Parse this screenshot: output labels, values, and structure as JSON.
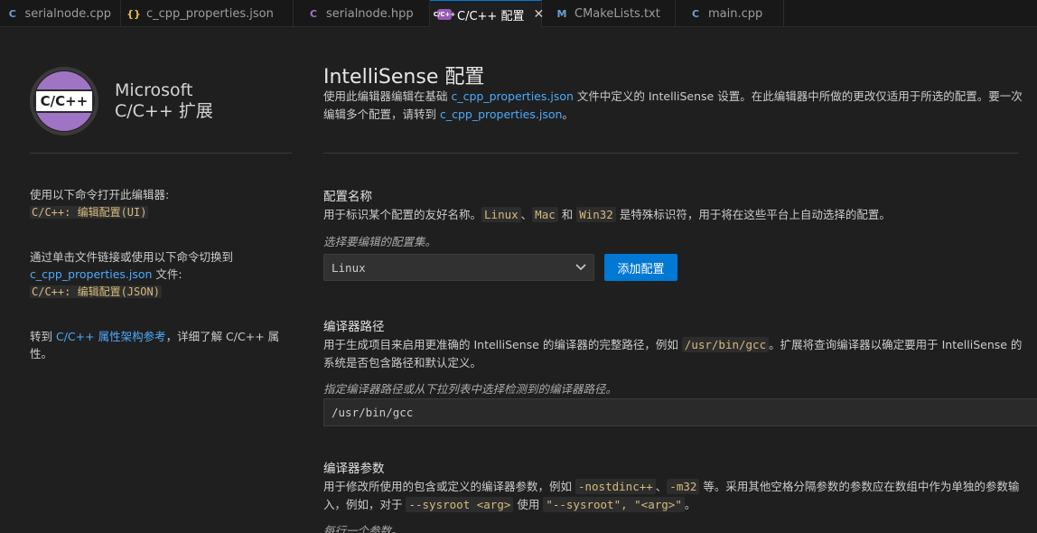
{
  "tabs": [
    {
      "label": "serialnode.cpp",
      "icon": "cpp-file-icon",
      "glyph": "C",
      "active": false
    },
    {
      "label": "c_cpp_properties.json",
      "icon": "json-file-icon",
      "glyph": "{}",
      "active": false
    },
    {
      "label": "serialnode.hpp",
      "icon": "hpp-file-icon",
      "glyph": "C",
      "active": false
    },
    {
      "label": "C/C++ 配置",
      "icon": "extension-icon",
      "glyph": "C/C++",
      "active": true
    },
    {
      "label": "CMakeLists.txt",
      "icon": "cmake-file-icon",
      "glyph": "M",
      "active": false
    },
    {
      "label": "main.cpp",
      "icon": "cpp-file-icon",
      "glyph": "C",
      "active": false
    }
  ],
  "tab_close_glyph": "✕",
  "sidebar": {
    "logo_text": "C/C++",
    "brand_line1": "Microsoft",
    "brand_line2": "C/C++ 扩展",
    "block1_text": "使用以下命令打开此编辑器:",
    "block1_cmd": "C/C++: 编辑配置(UI)",
    "block2_text": "通过单击文件链接或使用以下命令切换到",
    "block2_link": "c_cpp_properties.json",
    "block2_after": " 文件:",
    "block2_cmd": "C/C++: 编辑配置(JSON)",
    "block3_pre": "转到 ",
    "block3_link": "C/C++ 属性架构参考",
    "block3_post": "，详细了解 C/C++ 属性。"
  },
  "main": {
    "title": "IntelliSense 配置",
    "intro_1": "使用此编辑器编辑在基础 ",
    "intro_link1": "c_cpp_properties.json",
    "intro_2": " 文件中定义的 IntelliSense 设置。在此编辑器中所做的更改仅适用于所选的配置。要一次编辑多个配置，请转到 ",
    "intro_link2": "c_cpp_properties.json",
    "intro_3": "。",
    "config_name": {
      "title": "配置名称",
      "desc_1": "用于标识某个配置的友好名称。",
      "code_linux": "Linux",
      "sep": "、",
      "code_mac": "Mac",
      "and": " 和 ",
      "code_win": "Win32",
      "desc_2": " 是特殊标识符，用于将在这些平台上自动选择的配置。",
      "hint": "选择要编辑的配置集。",
      "select_value": "Linux",
      "add_button": "添加配置"
    },
    "compiler_path": {
      "title": "编译器路径",
      "desc_1": "用于生成项目来启用更准确的 IntelliSense 的编译器的完整路径，例如 ",
      "code": "/usr/bin/gcc",
      "desc_2": "。扩展将查询编译器以确定要用于 IntelliSense 的系统是否包含路径和默认定义。",
      "hint": "指定编译器路径或从下拉列表中选择检测到的编译器路径。",
      "value": "/usr/bin/gcc"
    },
    "compiler_args": {
      "title": "编译器参数",
      "desc_1": "用于修改所使用的包含或定义的编译器参数，例如 ",
      "code1": "-nostdinc++",
      "sep": "、",
      "code2": "-m32",
      "desc_2": " 等。采用其他空格分隔参数的参数应在数组中作为单独的参数输入，例如，对于 ",
      "code3": "--sysroot <arg>",
      "use": " 使用 ",
      "code4": "\"--sysroot\", \"<arg>\"",
      "end": "。",
      "hint": "每行一个参数。"
    }
  }
}
